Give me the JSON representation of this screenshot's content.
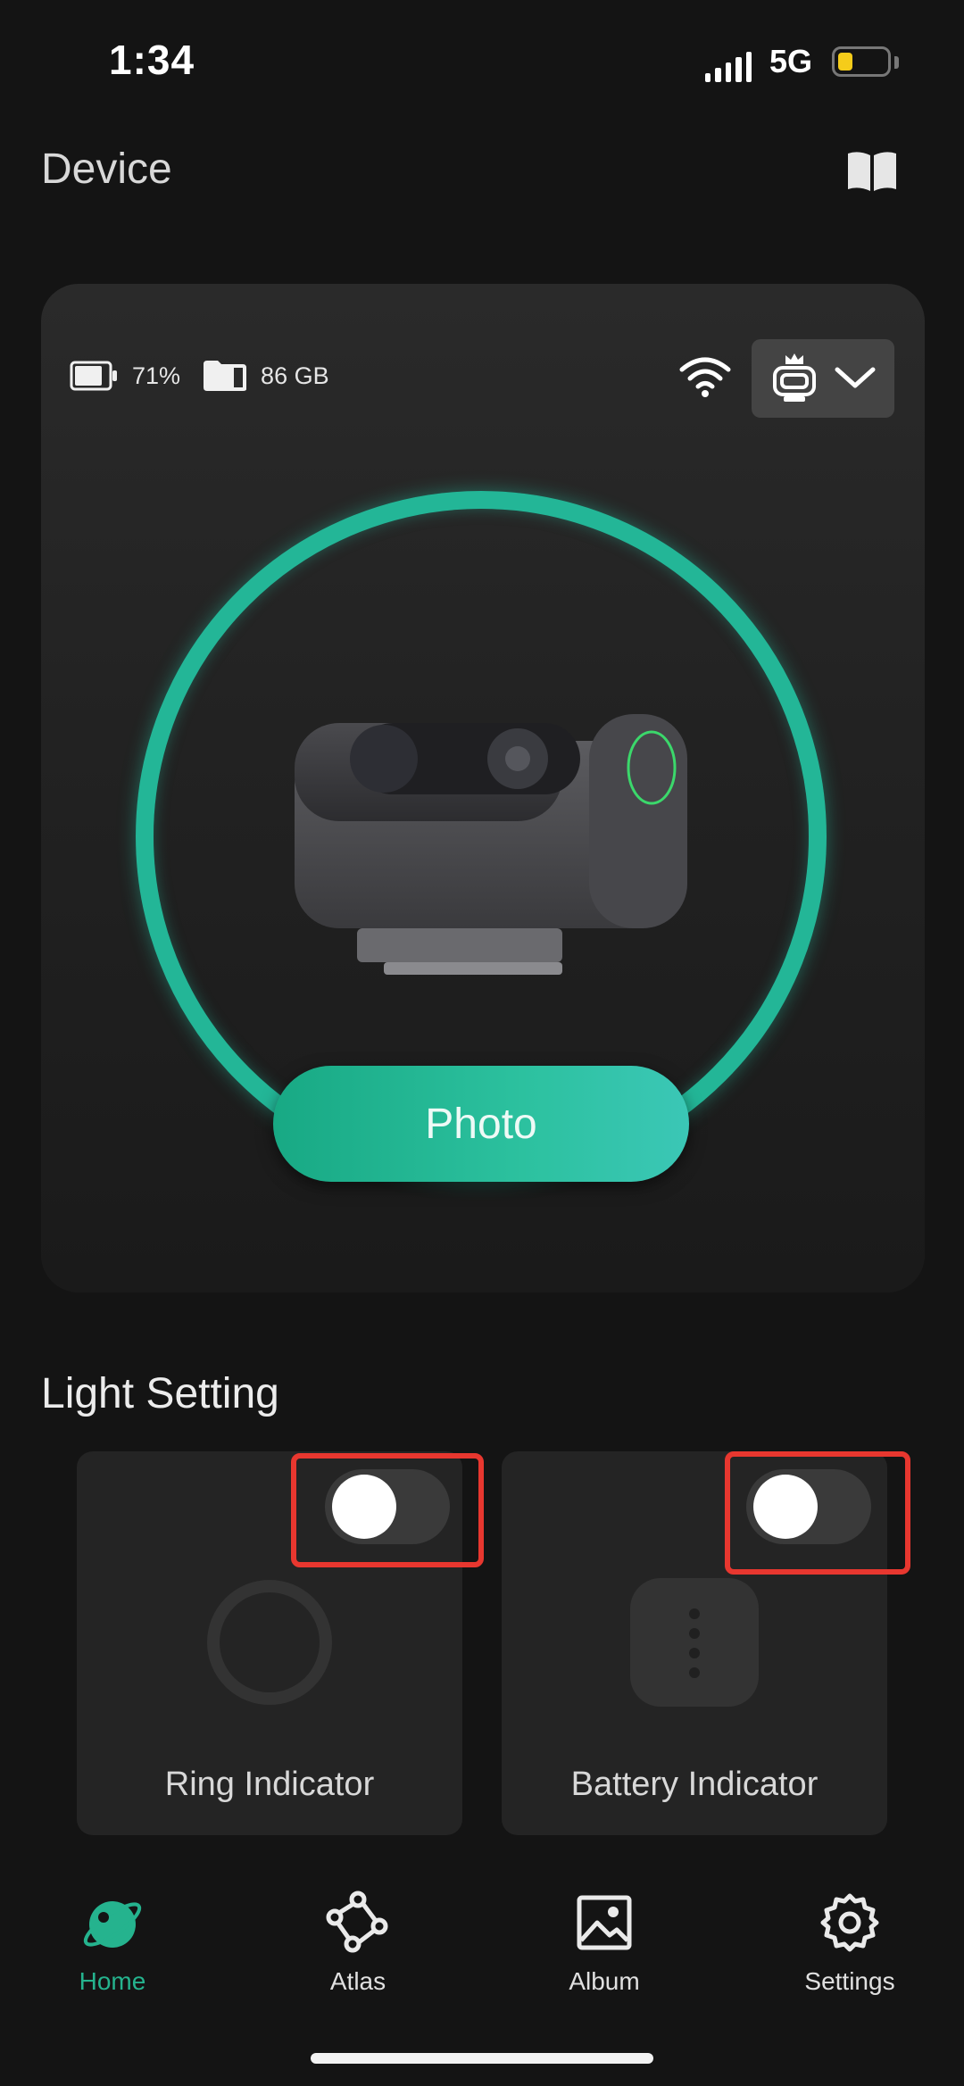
{
  "status_bar": {
    "time": "1:34",
    "network": "5G"
  },
  "header": {
    "title": "Device",
    "icon": "book-icon"
  },
  "device": {
    "battery": "71%",
    "storage": "86 GB",
    "mode_button": "Photo"
  },
  "light_setting": {
    "title": "Light Setting",
    "cards": [
      {
        "label": "Ring Indicator",
        "toggle_on": false
      },
      {
        "label": "Battery Indicator",
        "toggle_on": false
      }
    ]
  },
  "nav": {
    "items": [
      {
        "label": "Home",
        "icon": "home-planet-icon",
        "active": true
      },
      {
        "label": "Atlas",
        "icon": "atlas-nodes-icon",
        "active": false
      },
      {
        "label": "Album",
        "icon": "album-image-icon",
        "active": false
      },
      {
        "label": "Settings",
        "icon": "gear-icon",
        "active": false
      }
    ]
  },
  "colors": {
    "accent": "#23b697",
    "highlight": "#e8372f",
    "status_battery": "#f5cc1a"
  }
}
